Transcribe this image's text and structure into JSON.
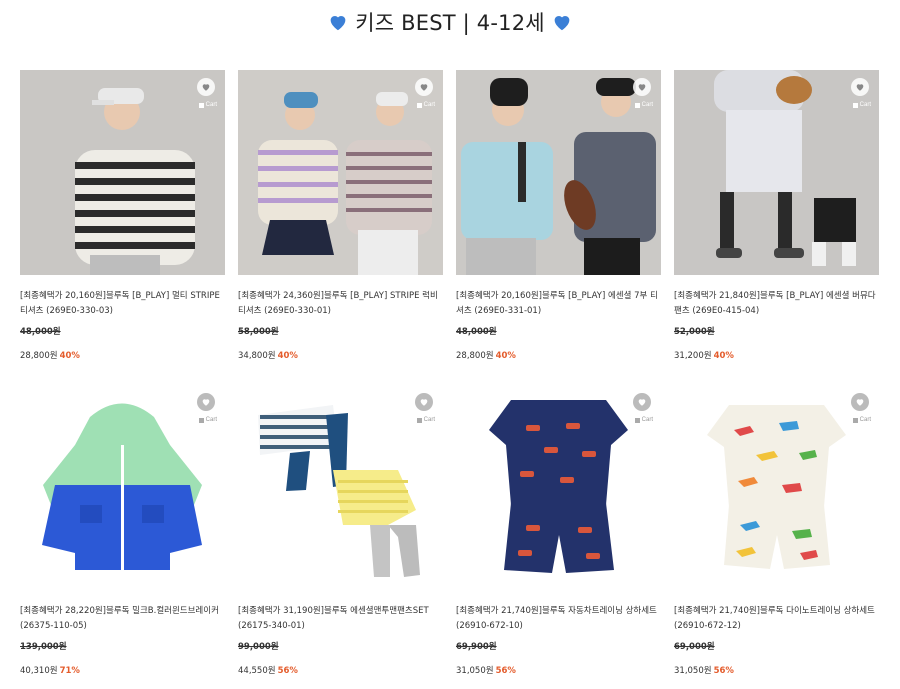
{
  "header": {
    "title": "키즈 BEST | 4-12세"
  },
  "cart_label": "Cart",
  "colors": {
    "sale": "#e45c2c",
    "heart": "#3b7fd6"
  },
  "products": [
    {
      "name": "[최종혜택가 20,160원]블루독 [B_PLAY] 멀티 STRIPE 티셔츠 (269E0-330-03)",
      "orig": "48,000원",
      "price": "28,800원",
      "sale": "40%"
    },
    {
      "name": "[최종혜택가 24,360원]블루독 [B_PLAY] STRIPE 럭비 티셔츠 (269E0-330-01)",
      "orig": "58,000원",
      "price": "34,800원",
      "sale": "40%"
    },
    {
      "name": "[최종혜택가 20,160원]블루독 [B_PLAY] 에센셜 7부 티셔츠 (269E0-331-01)",
      "orig": "48,000원",
      "price": "28,800원",
      "sale": "40%"
    },
    {
      "name": "[최종혜택가 21,840원]블루독 [B_PLAY] 에센셜 버뮤다 팬츠 (269E0-415-04)",
      "orig": "52,000원",
      "price": "31,200원",
      "sale": "40%"
    },
    {
      "name": "[최종혜택가 28,220원]블루독 밀크B.컬러윈드브레이커 (26375-110-05)",
      "orig": "139,000원",
      "price": "40,310원",
      "sale": "71%"
    },
    {
      "name": "[최종혜택가 31,190원]블루독 에센셜맨투맨팬츠SET (26175-340-01)",
      "orig": "99,000원",
      "price": "44,550원",
      "sale": "56%"
    },
    {
      "name": "[최종혜택가 21,740원]블루독 자동차트레이닝 상하세트 (26910-672-10)",
      "orig": "69,900원",
      "price": "31,050원",
      "sale": "56%"
    },
    {
      "name": "[최종혜택가 21,740원]블루독 다이노트레이닝 상하세트 (26910-672-12)",
      "orig": "69,000원",
      "price": "31,050원",
      "sale": "56%"
    }
  ]
}
